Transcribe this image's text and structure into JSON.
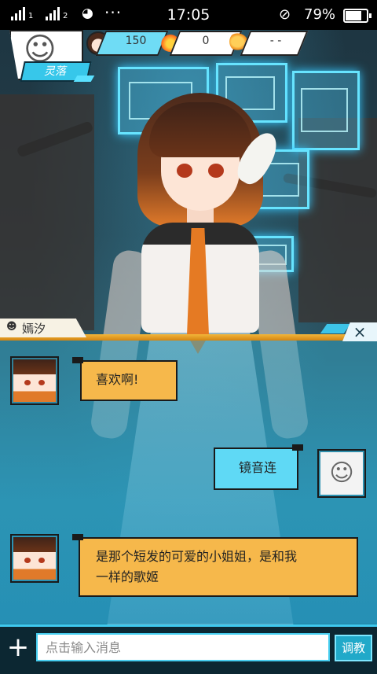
{
  "status_bar": {
    "signal1_label": "1",
    "signal2_label": "2",
    "time": "17:05",
    "battery_percent": "79%",
    "battery_level": 0.79
  },
  "hud": {
    "character_name": "灵落",
    "stat_1_value": "150",
    "stat_2_value": "0",
    "stat_3_value": "- -"
  },
  "dialog": {
    "speaker_name": "嫣汐",
    "close_label": "×",
    "messages": [
      {
        "side": "left",
        "text": "喜欢啊!"
      },
      {
        "side": "right",
        "text": "镜音连"
      },
      {
        "side": "left",
        "text_line1": "是那个短发的可爱的小姐姐，是和我",
        "text_line2": "一样的歌姬"
      }
    ]
  },
  "input": {
    "placeholder": "点击输入消息",
    "value": "",
    "tune_label": "调教",
    "plus_label": "+"
  },
  "colors": {
    "accent_cyan": "#3fc9ee",
    "bubble_orange": "#f6b84b",
    "bubble_cyan": "#5fd9f5",
    "header_gold": "#f2b63a"
  }
}
